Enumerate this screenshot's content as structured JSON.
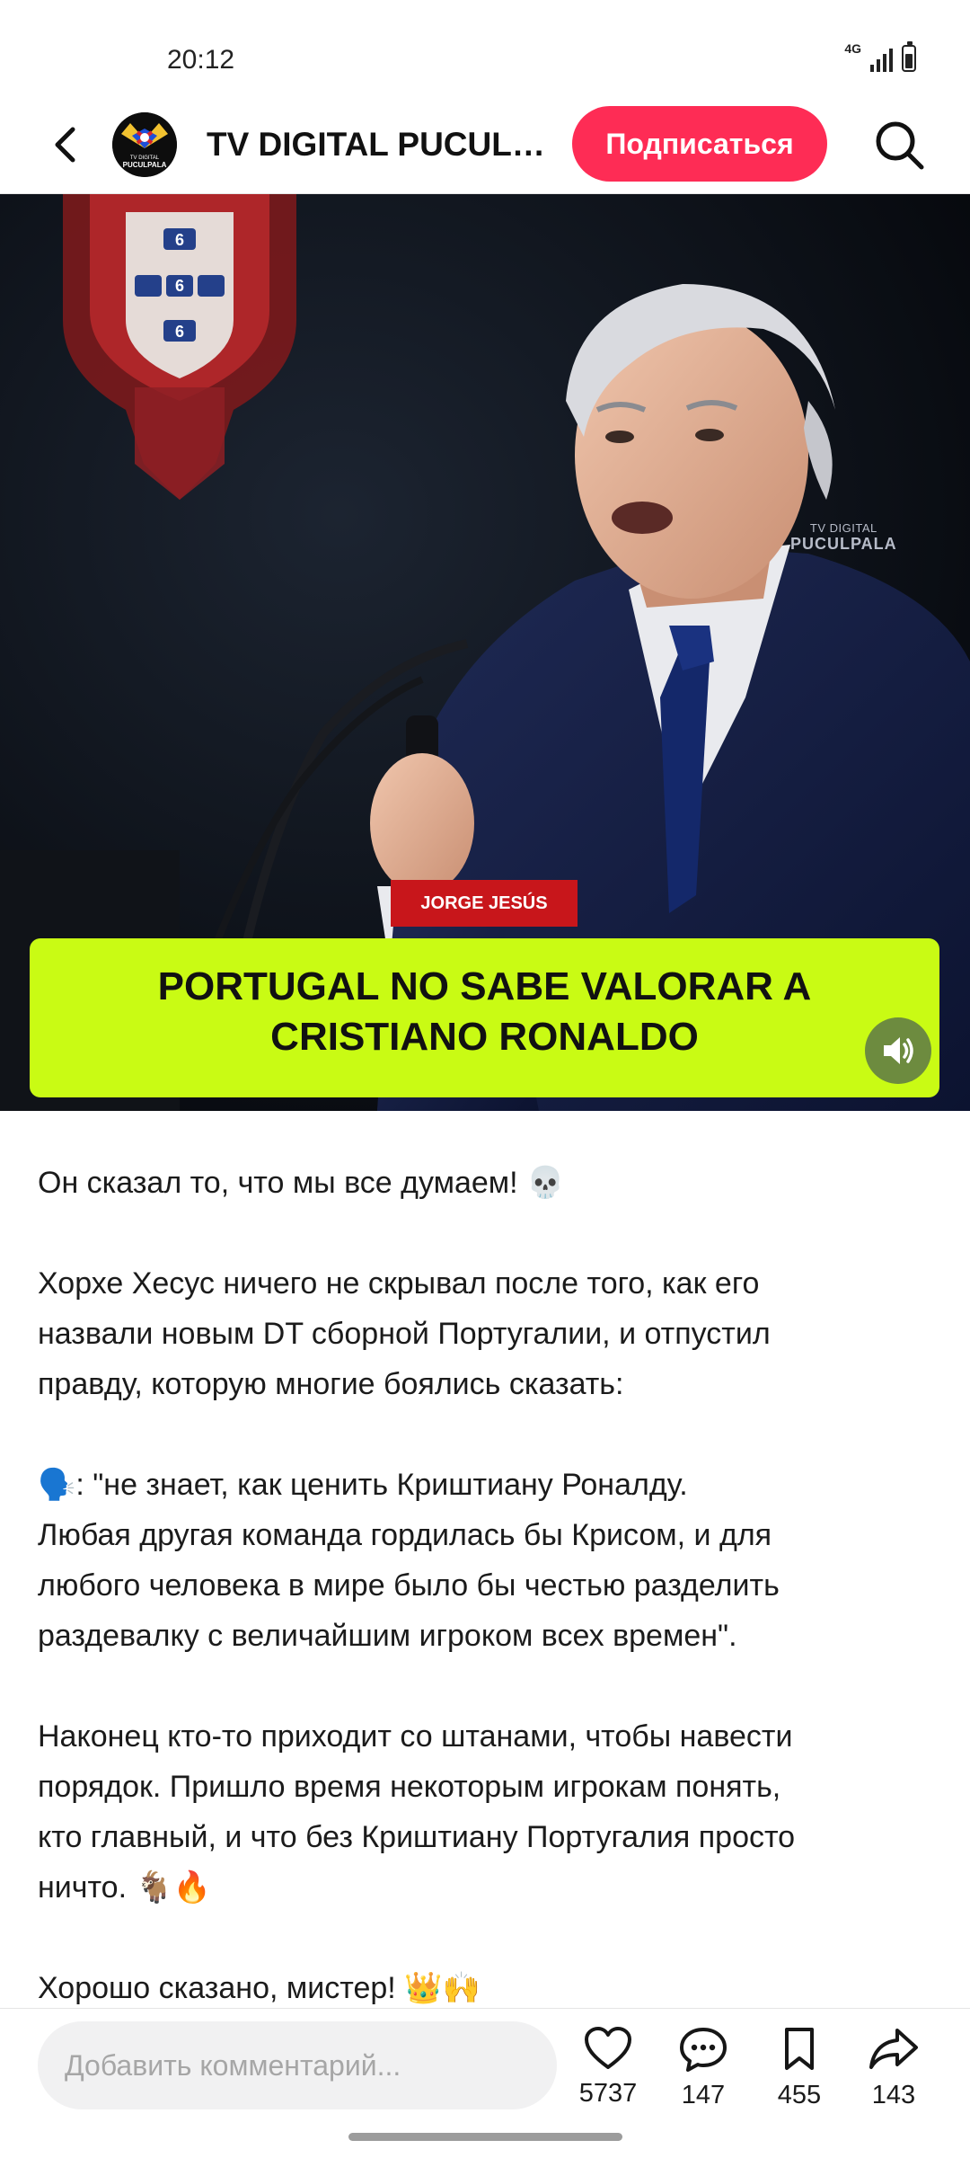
{
  "status_bar": {
    "time": "20:12",
    "network": "4G"
  },
  "header": {
    "back_icon": "chevron-left-icon",
    "avatar_text": [
      "TV DIGITAL",
      "PUCULPALA"
    ],
    "channel_name": "TV DIGITAL PUCULPALA",
    "subscribe_label": "Подписаться",
    "search_icon": "search-icon"
  },
  "media": {
    "watermark_top": "TV DIGITAL",
    "watermark_bottom": "PUCULPALA",
    "emblem_text": [
      "6",
      "6",
      "6"
    ],
    "name_tag": "JORGE JESÚS",
    "headline": "PORTUGAL NO SABE VALORAR A CRISTIANO RONALDO",
    "sound_icon": "speaker-icon",
    "accent_color": "#c9fb14"
  },
  "caption": {
    "p1": "Он сказал то, что мы все думаем! 💀",
    "p2": "Хорхе Хесус ничего не скрывал после того, как его\nназвали новым DT сборной Португалии, и отпустил\nправду, которую многие боялись сказать:",
    "p3": "🗣️: \"не знает, как ценить Криштиану Роналду.\nЛюбая другая команда гордилась бы Крисом, и для\nлюбого человека в мире было бы честью разделить\nраздевалку с величайшим игроком всех времен\".",
    "p4": "Наконец кто-то приходит со штанами, чтобы навести\nпорядок. Пришло время некоторым игрокам понять,\nкто главный, и что без Криштиану Португалия просто\nничто. 🐐🔥",
    "p5": "Хорошо сказано, мистер! 👑🙌"
  },
  "bottom_bar": {
    "comment_placeholder": "Добавить комментарий...",
    "likes": "5737",
    "comments": "147",
    "saves": "455",
    "shares": "143"
  },
  "colors": {
    "subscribe": "#fe2c55",
    "name_tag": "#c8161b"
  }
}
